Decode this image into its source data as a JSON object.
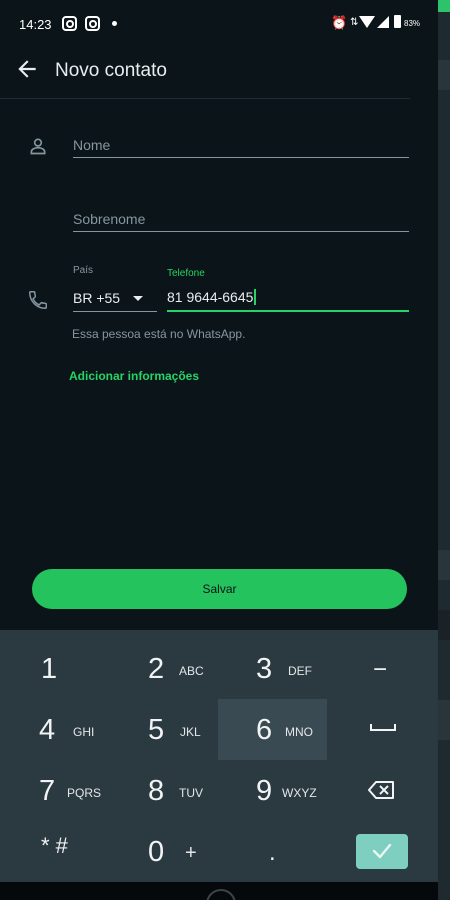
{
  "status_bar": {
    "time": "14:23",
    "battery": "83%"
  },
  "app_bar": {
    "title": "Novo contato"
  },
  "form": {
    "first_name_placeholder": "Nome",
    "last_name_placeholder": "Sobrenome",
    "country_label": "País",
    "country_value": "BR +55",
    "phone_label": "Telefone",
    "phone_value": "81 9644-6645",
    "whatsapp_hint": "Essa pessoa está no WhatsApp.",
    "add_info": "Adicionar informações",
    "save_label": "Salvar"
  },
  "keypad": {
    "keys": [
      {
        "num": "1",
        "letters": ""
      },
      {
        "num": "2",
        "letters": "ABC"
      },
      {
        "num": "3",
        "letters": "DEF"
      },
      {
        "num": "−",
        "letters": ""
      },
      {
        "num": "4",
        "letters": "GHI"
      },
      {
        "num": "5",
        "letters": "JKL"
      },
      {
        "num": "6",
        "letters": "MNO"
      },
      {
        "num": "7",
        "letters": "PQRS"
      },
      {
        "num": "8",
        "letters": "TUV"
      },
      {
        "num": "9",
        "letters": "WXYZ"
      },
      {
        "num": "* #",
        "letters": ""
      },
      {
        "num": "0",
        "letters": "+"
      },
      {
        "num": ".",
        "letters": ""
      }
    ]
  },
  "colors": {
    "accent": "#25d366",
    "background": "#0b1418",
    "keypad": "#2b3a41"
  }
}
